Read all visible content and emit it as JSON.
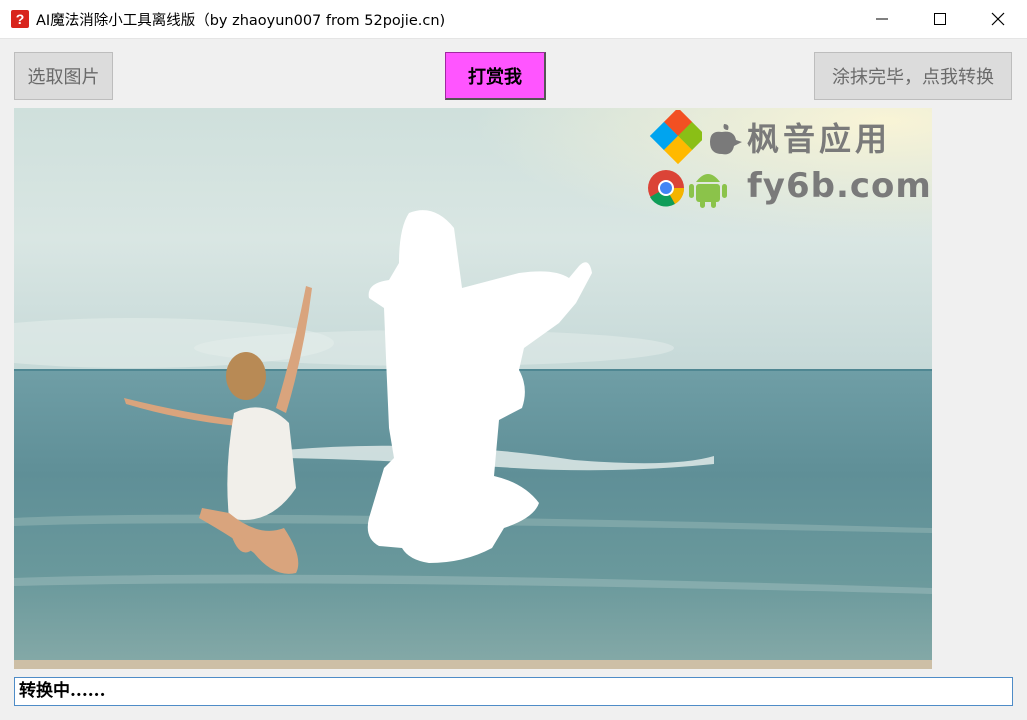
{
  "window": {
    "icon": "question-mark-icon",
    "title": "AI魔法消除小工具离线版（by zhaoyun007 from 52pojie.cn)",
    "controls": [
      "minimize-icon",
      "maximize-icon",
      "close-icon"
    ]
  },
  "toolbar": {
    "pick_image_label": "选取图片",
    "reward_label": "打赏我",
    "convert_label": "涂抹完毕，点我转换",
    "reward_color": "#ff55ff"
  },
  "canvas": {
    "image": "beach-photo-jumping-girl",
    "mask": "white-brush-mask",
    "watermark": {
      "name": "枫音应用",
      "url": "fy6b.com",
      "icons": [
        "windows-logo-icon",
        "apple-logo-icon",
        "chrome-icon",
        "android-icon"
      ]
    }
  },
  "status": {
    "text": "转换中......"
  }
}
